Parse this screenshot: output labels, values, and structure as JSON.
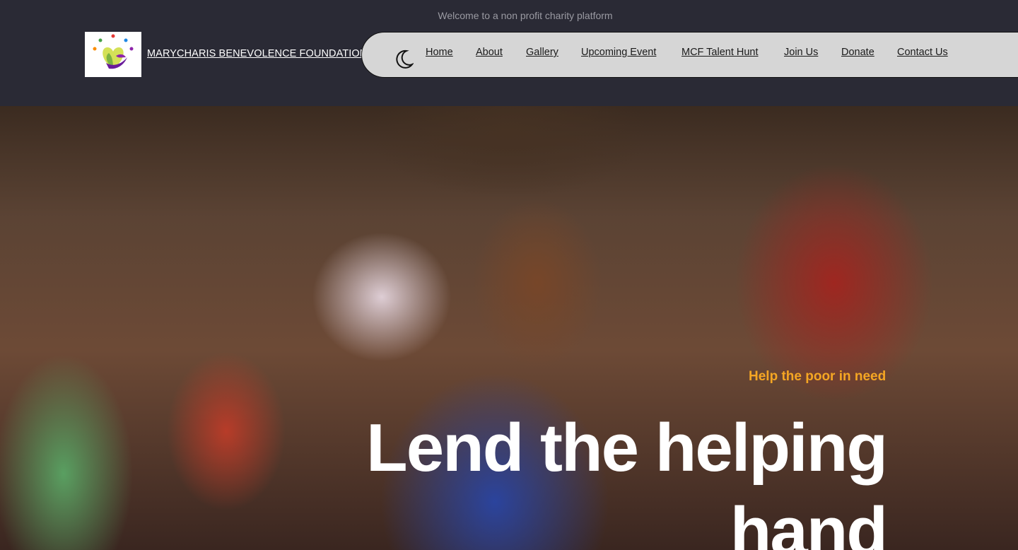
{
  "header": {
    "welcome_text": "Welcome to a non profit charity platform",
    "org_name": "MARYCHARIS BENEVOLENCE FOUNDATION"
  },
  "nav": {
    "theme_toggle_icon": "moon-icon",
    "items": [
      {
        "label": "Home"
      },
      {
        "label": "About"
      },
      {
        "label": "Gallery"
      },
      {
        "label": "Upcoming Event"
      },
      {
        "label": "MCF Talent Hunt"
      },
      {
        "label": "Join Us"
      },
      {
        "label": "Donate"
      },
      {
        "label": "Contact Us"
      }
    ]
  },
  "hero": {
    "tagline": "Help the poor in need",
    "title": "Lend the helping hand"
  },
  "colors": {
    "header_bg": "#2a2a35",
    "nav_bg": "#d6d6d6",
    "accent": "#f5a623"
  }
}
